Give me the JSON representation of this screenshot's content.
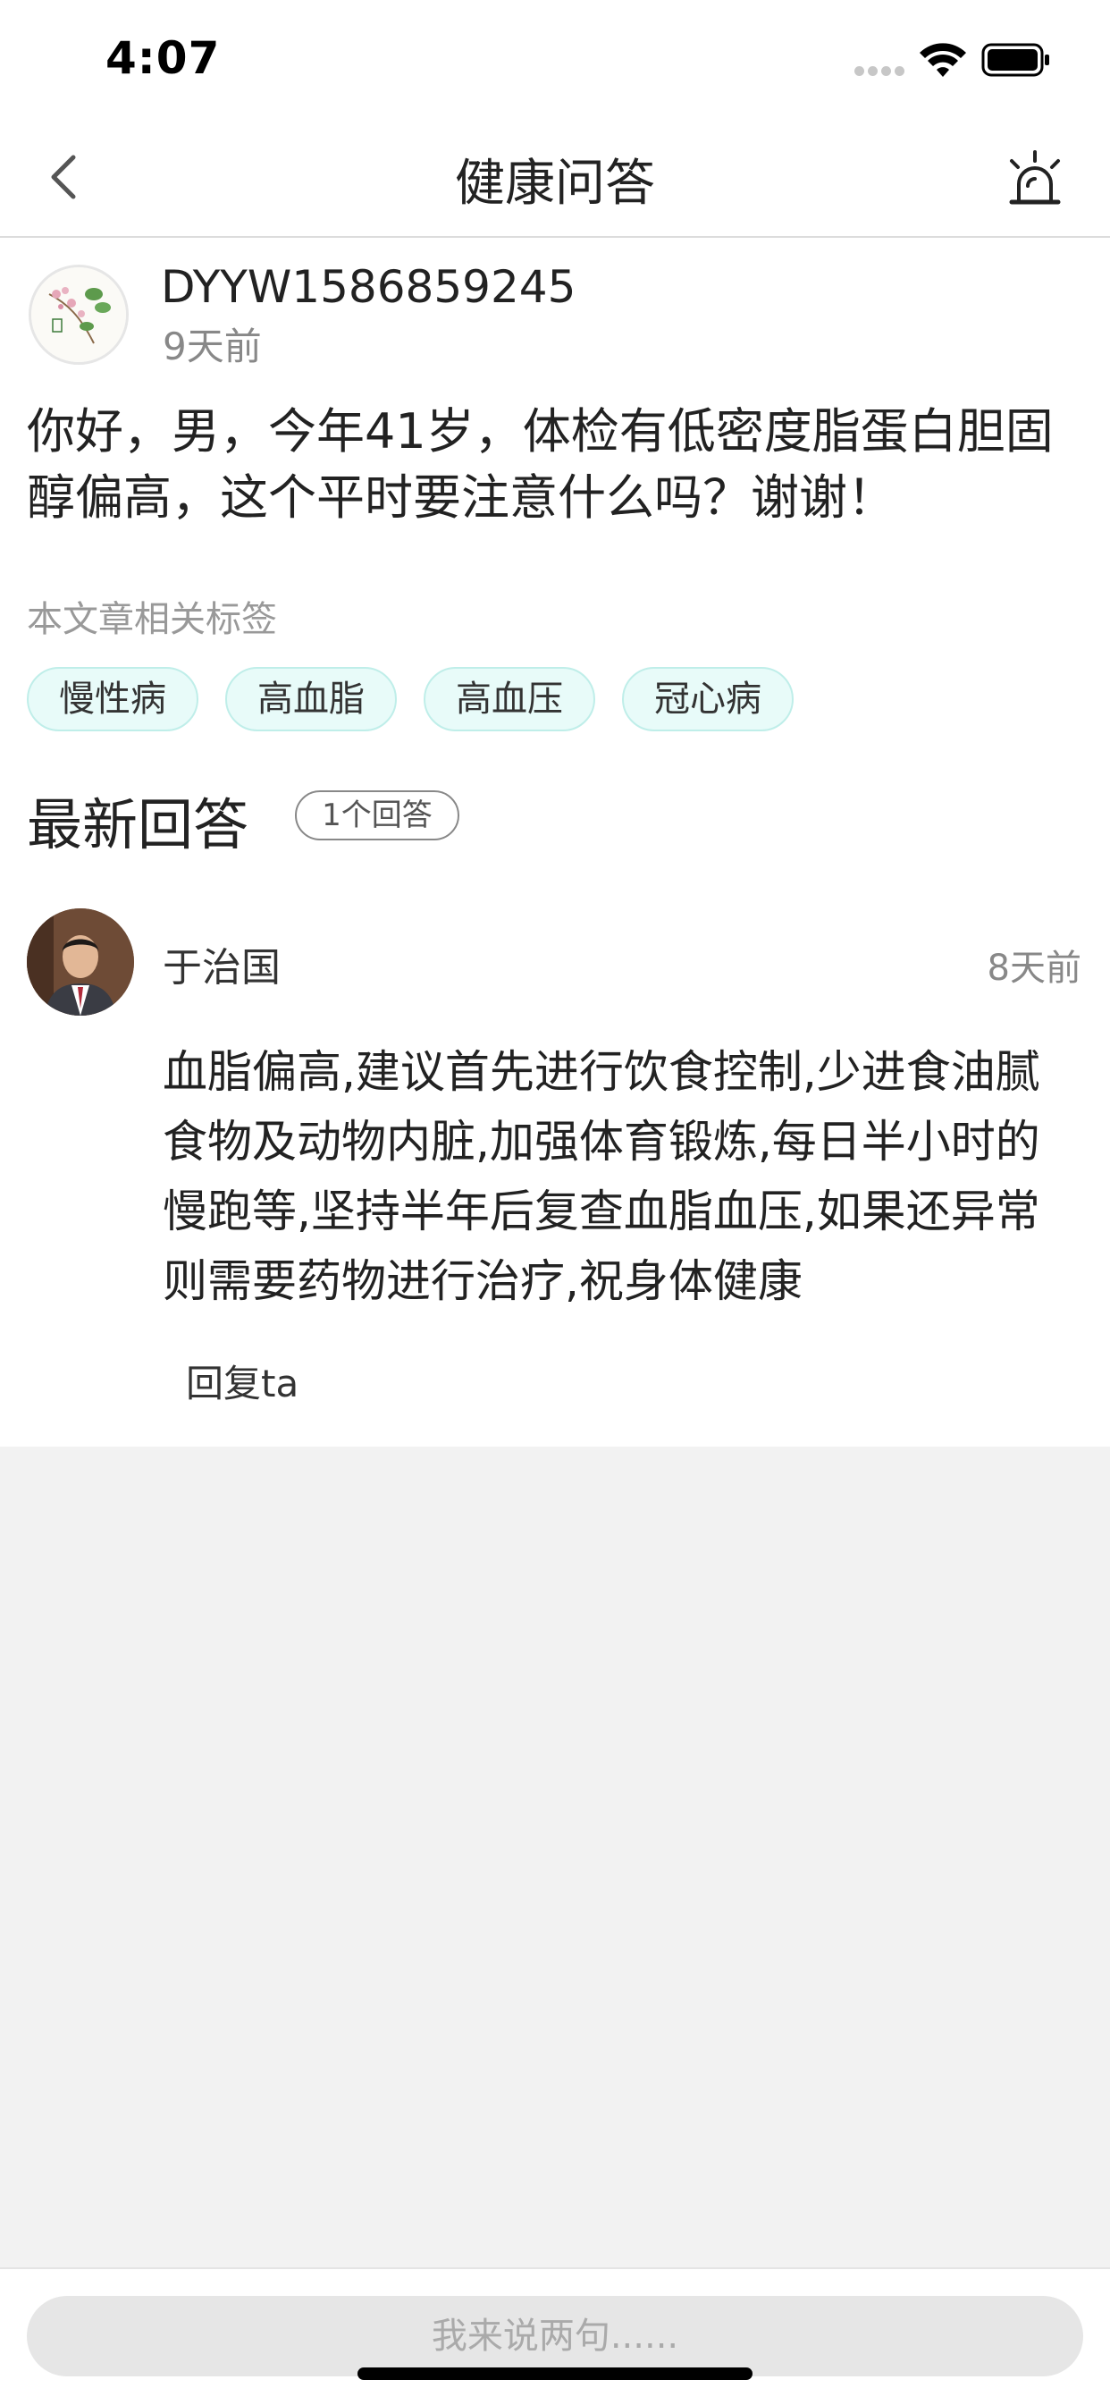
{
  "status_bar": {
    "time": "4:07"
  },
  "nav": {
    "title": "健康问答",
    "icons": [
      "back-chevron-icon",
      "alarm-siren-icon"
    ]
  },
  "question": {
    "asker_name": "DYYW1586859245",
    "time_ago": "9天前",
    "text": "你好，男，今年41岁，体检有低密度脂蛋白胆固醇偏高，这个平时要注意什么吗？谢谢！"
  },
  "tags": {
    "label": "本文章相关标签",
    "items": [
      "慢性病",
      "高血脂",
      "高血压",
      "冠心病"
    ]
  },
  "answers_section": {
    "title": "最新回答",
    "count_label": "1个回答"
  },
  "answer": {
    "doctor_name": "于治国",
    "time_ago": "8天前",
    "text": "血脂偏高,建议首先进行饮食控制,少进食油腻食物及动物内脏,加强体育锻炼,每日半小时的慢跑等,坚持半年后复查血脂血压,如果还异常则需要药物进行治疗,祝身体健康",
    "reply_label": "回复ta"
  },
  "comment": {
    "placeholder": "我来说两句......"
  },
  "colors": {
    "tag_background": "#e8fbf9",
    "tag_border": "#bfeee9",
    "page_background": "#f2f2f2"
  }
}
